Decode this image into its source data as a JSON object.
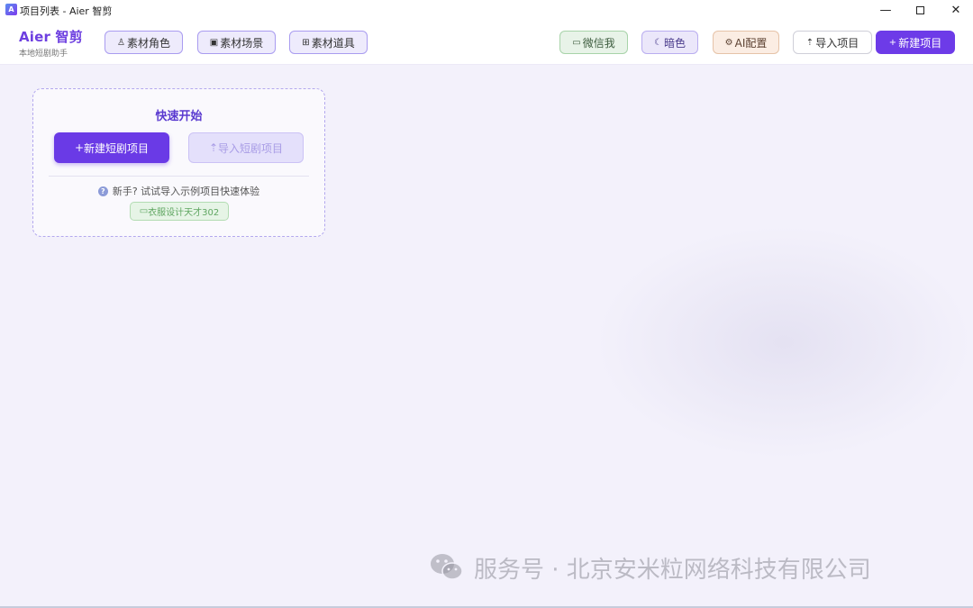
{
  "window": {
    "title": "项目列表 - Aier 智剪",
    "app_icon_text": "A",
    "min_symbol": "—",
    "close_symbol": "✕"
  },
  "header": {
    "brand_title": "Aier 智剪",
    "brand_subtitle": "本地短剧助手",
    "buttons": {
      "material_role": "素材角色",
      "material_scene": "素材场景",
      "material_prop": "素材道具",
      "wechat": "微信我",
      "dark": "暗色",
      "ai_config": "AI配置",
      "import_project": "导入项目",
      "new_project": "新建项目"
    },
    "icons": {
      "role": "♙",
      "scene": "▣",
      "prop": "⊞",
      "wechat": "▭",
      "dark": "☾",
      "ai": "⚙",
      "import": "⇡",
      "new": "+"
    }
  },
  "quick_start": {
    "title": "快速开始",
    "new_button": "新建短剧项目",
    "new_icon": "+",
    "import_button": "导入短剧项目",
    "import_icon": "⇡",
    "hint": "新手? 试试导入示例项目快速体验",
    "help_icon": "?",
    "sample_chip": "衣服设计天才302",
    "sample_icon": "▭"
  },
  "watermark": {
    "text": "服务号 · 北京安米粒网络科技有限公司"
  },
  "colors": {
    "accent": "#6d3be8",
    "brand": "#6d3fe0",
    "background": "#f3f1fb"
  }
}
